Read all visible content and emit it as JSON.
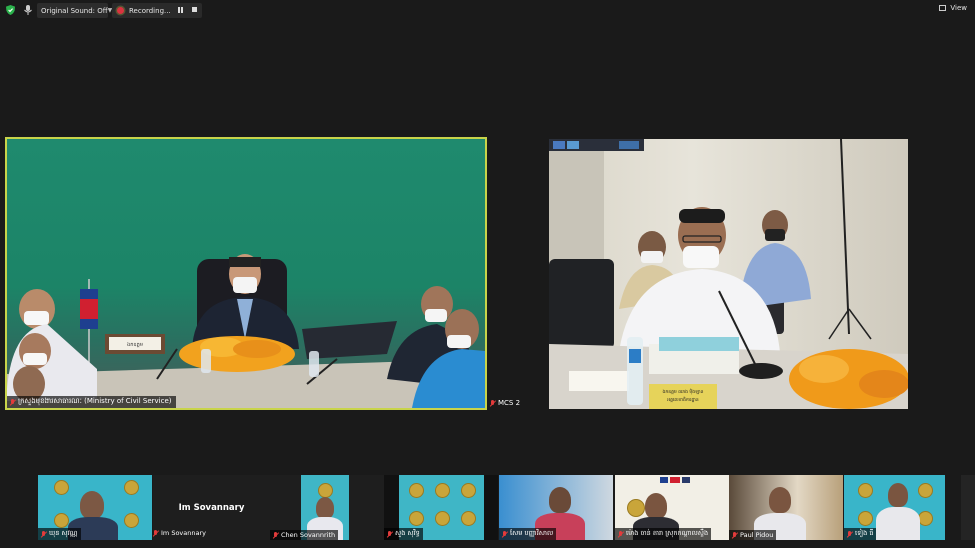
{
  "toolbar": {
    "original_sound": "Original Sound: Off",
    "recording": "Recording...",
    "view": "View"
  },
  "main_video": {
    "name": "ក្រសួងមុខងារសាធារណៈ (Ministry of Civil Service)",
    "desk_sign": "ឯកឧត្តម",
    "background_color": "#1f8a6e",
    "highlight_border": "#c8d44a"
  },
  "second_video": {
    "name": "MCS 2",
    "desk_sign_line1": "ឯកឧត្តម ឈាង ម៉ិងឡាន",
    "desk_sign_line2": "អគ្គលេខាធិការដ្ឋាន"
  },
  "gallery": [
    {
      "name": "ឃុន សុវណ្ណ"
    },
    {
      "name": "Im Sovannary",
      "display": "Im Sovannary"
    },
    {
      "name": "Chen Sovannrith"
    },
    {
      "name": "សួង សុវិទ្ធ"
    },
    {
      "name": "សែម បញ្ញាវិសាល"
    },
    {
      "name": "ម៉ោង ចាន់ តារា ស្រុកកណ្ដាលស្ទឹង"
    },
    {
      "name": "Paul Pidou"
    },
    {
      "name": "ទៀង ធី"
    }
  ],
  "colors": {
    "mute_red": "#e23b3b",
    "recording_red": "#d9333f",
    "gallery_badge_bg": "#39b5c9"
  }
}
